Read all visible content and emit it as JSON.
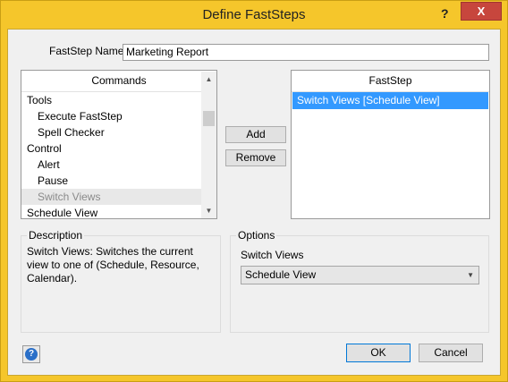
{
  "window": {
    "title": "Define FastSteps",
    "help_glyph": "?",
    "close_glyph": "X"
  },
  "name_field": {
    "label": "FastStep Name:",
    "value": "Marketing Report"
  },
  "commands": {
    "header": "Commands",
    "items": [
      {
        "label": "Tools"
      },
      {
        "label": "Execute FastStep"
      },
      {
        "label": "Spell Checker"
      },
      {
        "label": "Control"
      },
      {
        "label": "Alert"
      },
      {
        "label": "Pause"
      },
      {
        "label": "Switch Views"
      },
      {
        "label": "Schedule View"
      }
    ]
  },
  "buttons": {
    "add": "Add",
    "remove": "Remove",
    "ok": "OK",
    "cancel": "Cancel",
    "help": "?"
  },
  "faststep": {
    "header": "FastStep",
    "items": [
      {
        "label": "Switch Views [Schedule View]"
      }
    ]
  },
  "description": {
    "legend": "Description",
    "text": "Switch Views: Switches the current view to one of (Schedule, Resource, Calendar)."
  },
  "options": {
    "legend": "Options",
    "label": "Switch Views",
    "selected": "Schedule View"
  },
  "icons": {
    "close": "close-icon",
    "help": "help-icon",
    "scroll_up": "chevron-up-icon",
    "scroll_down": "chevron-down-icon",
    "dropdown": "chevron-down-icon"
  },
  "colors": {
    "title_bar": "#f5c62b",
    "close_button": "#c7463d",
    "selection": "#3399ff",
    "dialog": "#f0f0f0"
  }
}
